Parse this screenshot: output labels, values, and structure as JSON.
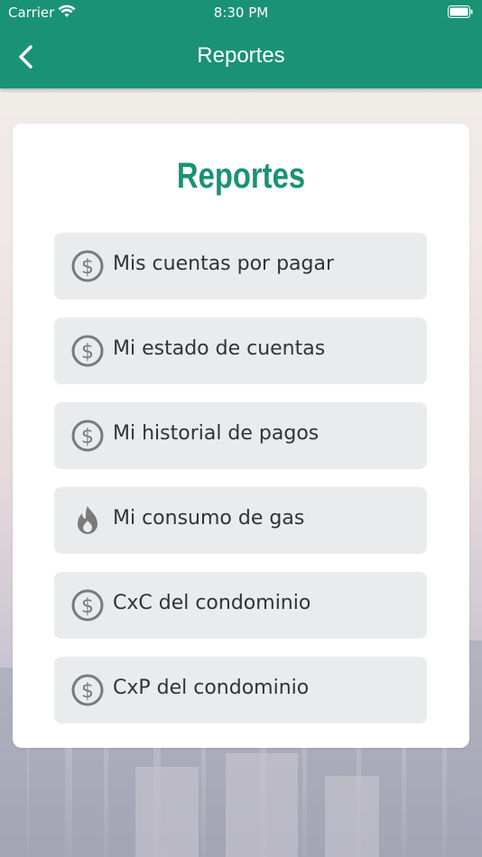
{
  "status_bar": {
    "carrier": "Carrier",
    "time": "8:30 PM"
  },
  "nav": {
    "title": "Reportes",
    "back_icon": "chevron-left-icon"
  },
  "card": {
    "title": "Reportes",
    "items": [
      {
        "label": "Mis cuentas por pagar",
        "icon": "dollar-circle-icon"
      },
      {
        "label": "Mi estado de cuentas",
        "icon": "dollar-circle-icon"
      },
      {
        "label": "Mi historial de pagos",
        "icon": "dollar-circle-icon"
      },
      {
        "label": "Mi consumo de gas",
        "icon": "flame-icon"
      },
      {
        "label": "CxC del condominio",
        "icon": "dollar-circle-icon"
      },
      {
        "label": "CxP del condominio",
        "icon": "dollar-circle-icon"
      }
    ]
  },
  "colors": {
    "primary": "#1a9275",
    "item_bg": "#eaebed",
    "icon": "#7a7a7a"
  }
}
